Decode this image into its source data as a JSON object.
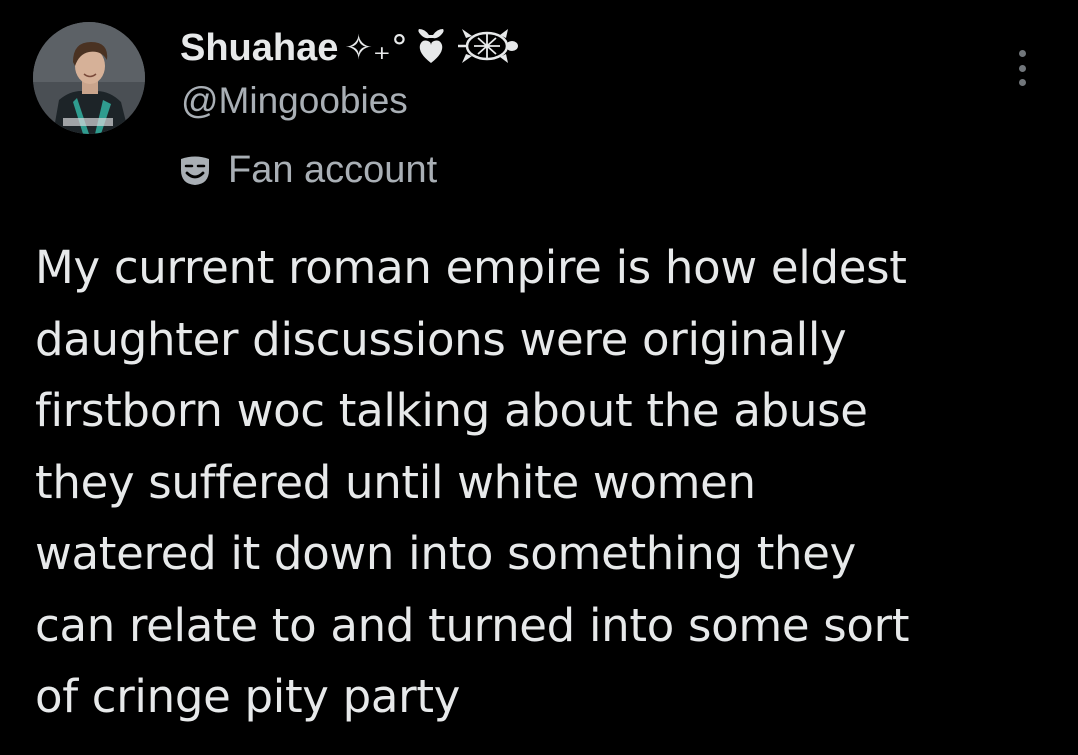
{
  "author": {
    "display_name": "Shuahae",
    "display_name_emoji": "✧₊°",
    "handle": "@Mingoobies",
    "badge_label": "Fan account",
    "decor_icons": [
      "bow-heart-icon",
      "turtle-icon"
    ]
  },
  "header": {
    "more_icon": "more-dots-icon"
  },
  "tweet": {
    "text": "My current roman empire is how eldest\ndaughter discussions were originally\nfirstborn woc talking about the abuse\nthey suffered until white women\nwatered it down into something they\ncan relate to and turned into some sort\nof cringe pity party"
  },
  "colors": {
    "background": "#000000",
    "primary_text": "#e7e9ea",
    "secondary_text": "#a9afb5",
    "icon_gray": "#71767b"
  }
}
